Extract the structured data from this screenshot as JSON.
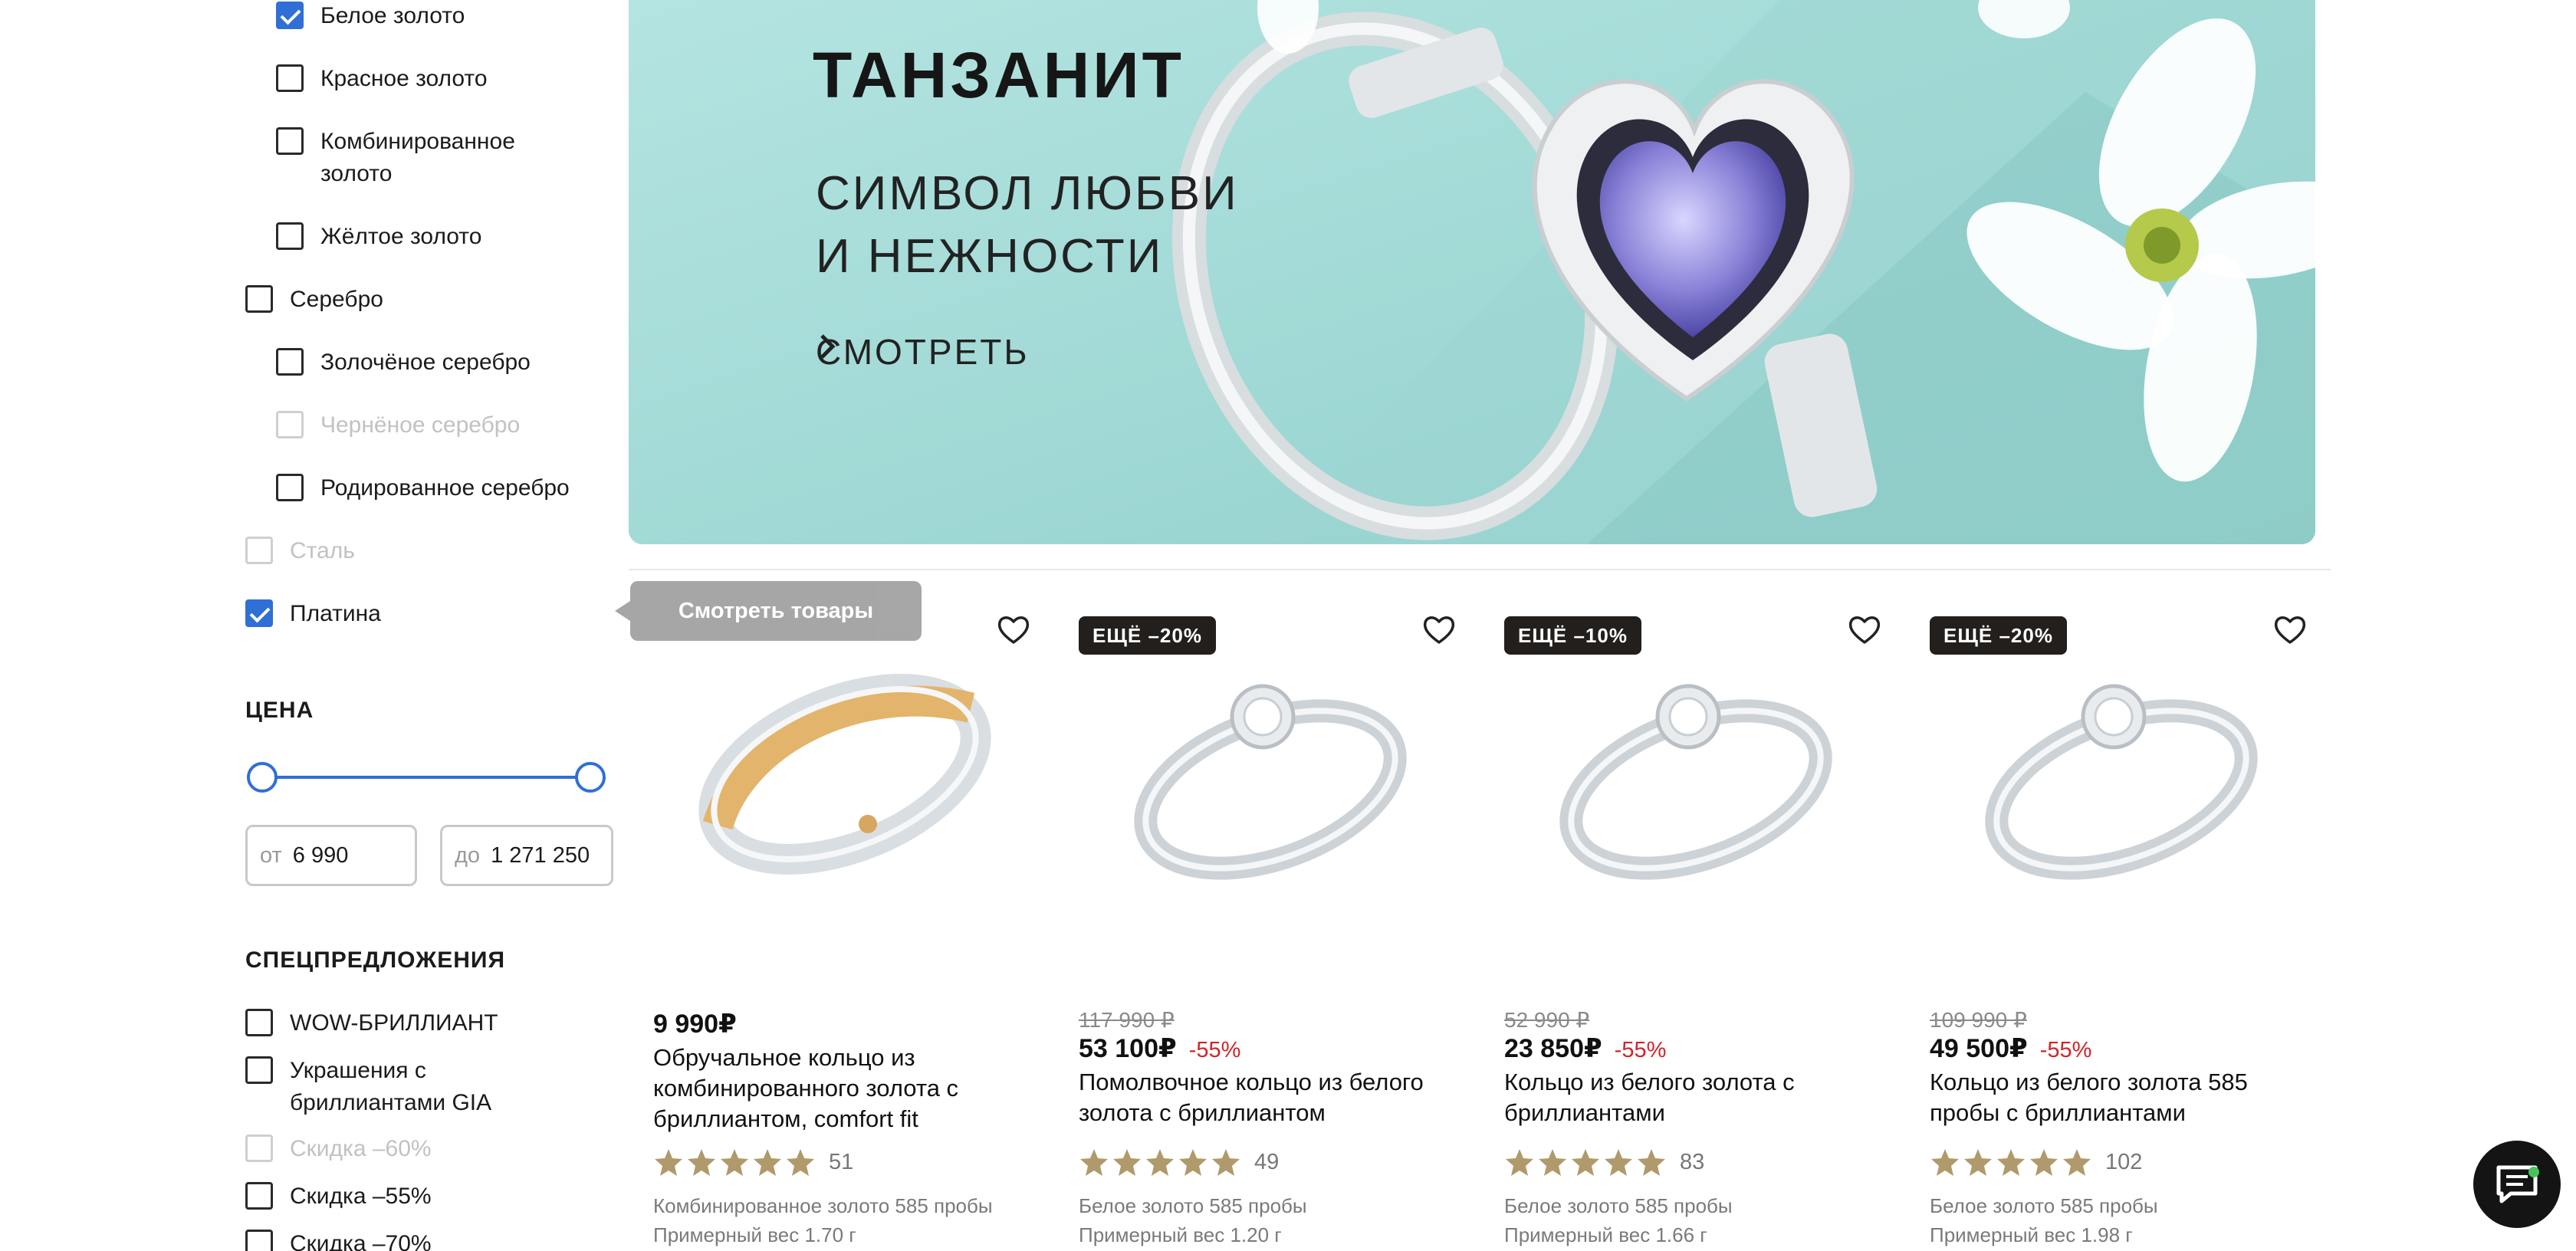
{
  "filters": {
    "metal_options": [
      {
        "label": "Белое золото",
        "checked": true,
        "disabled": false,
        "indent": true
      },
      {
        "label": "Красное золото",
        "checked": false,
        "disabled": false,
        "indent": true
      },
      {
        "label": "Комбинированное золото",
        "checked": false,
        "disabled": false,
        "indent": true
      },
      {
        "label": "Жёлтое золото",
        "checked": false,
        "disabled": false,
        "indent": true
      },
      {
        "label": "Серебро",
        "checked": false,
        "disabled": false,
        "indent": false
      },
      {
        "label": "Золочёное серебро",
        "checked": false,
        "disabled": false,
        "indent": true
      },
      {
        "label": "Чернёное серебро",
        "checked": false,
        "disabled": true,
        "indent": true
      },
      {
        "label": "Родированное серебро",
        "checked": false,
        "disabled": false,
        "indent": true
      },
      {
        "label": "Сталь",
        "checked": false,
        "disabled": true,
        "indent": false
      },
      {
        "label": "Платина",
        "checked": true,
        "disabled": false,
        "indent": false
      }
    ],
    "price": {
      "title": "ЦЕНА",
      "from_prefix": "от",
      "from_value": "6 990",
      "to_prefix": "до",
      "to_value": "1 271 250"
    },
    "special": {
      "title": "СПЕЦПРЕДЛОЖЕНИЯ",
      "options": [
        {
          "label": "WOW-БРИЛЛИАНТ",
          "checked": false,
          "disabled": false
        },
        {
          "label": "Украшения с бриллиантами GIA",
          "checked": false,
          "disabled": false
        },
        {
          "label": "Скидка –60%",
          "checked": false,
          "disabled": true
        },
        {
          "label": "Скидка –55%",
          "checked": false,
          "disabled": false
        },
        {
          "label": "Скидка –70%",
          "checked": false,
          "disabled": false
        }
      ]
    }
  },
  "tooltip": {
    "label": "Смотреть товары"
  },
  "banner": {
    "title": "ТАНЗАНИТ",
    "subtitle_line1": "СИМВОЛ ЛЮБВИ",
    "subtitle_line2": "И НЕЖНОСТИ",
    "cta": "СМОТРЕТЬ",
    "cta_icon": "chevron-right-icon"
  },
  "products": [
    {
      "badge": "",
      "badge_style": "blue",
      "old_price": "",
      "price": "9 990₽",
      "discount": "",
      "title": "Обручальное кольцо из комбинированного золота с бриллиантом, comfort fit",
      "rating": 5,
      "reviews": "51",
      "material": "Комбинированное золото 585 пробы",
      "weight": "Примерный вес 1.70 г",
      "ring_color": "two-tone"
    },
    {
      "badge": "ЕЩЁ –20%",
      "badge_style": "dark",
      "old_price": "117 990 ₽",
      "price": "53 100₽",
      "discount": "-55%",
      "title": "Помолвочное кольцо из белого золота с бриллиантом",
      "rating": 5,
      "reviews": "49",
      "material": "Белое золото 585 пробы",
      "weight": "Примерный вес 1.20 г",
      "ring_color": "white"
    },
    {
      "badge": "ЕЩЁ –10%",
      "badge_style": "dark",
      "old_price": "52 990 ₽",
      "price": "23 850₽",
      "discount": "-55%",
      "title": "Кольцо из белого золота с бриллиантами",
      "rating": 5,
      "reviews": "83",
      "material": "Белое золото 585 пробы",
      "weight": "Примерный вес 1.66 г",
      "ring_color": "white"
    },
    {
      "badge": "ЕЩЁ –20%",
      "badge_style": "dark",
      "old_price": "109 990 ₽",
      "price": "49 500₽",
      "discount": "-55%",
      "title": "Кольцо из белого золота 585 пробы с бриллиантами",
      "rating": 5,
      "reviews": "102",
      "material": "Белое золото 585 пробы",
      "weight": "Примерный вес 1.98 г",
      "ring_color": "white"
    }
  ],
  "icons": {
    "heart": "heart-outline-icon",
    "star": "star-icon",
    "chat": "chat-icon"
  },
  "colors": {
    "accent_blue": "#2f6fd6",
    "banner_bg": "#a8dcda",
    "discount_red": "#d2232a",
    "star_gold": "#b09a6b",
    "badge_dark": "#231f1c"
  }
}
